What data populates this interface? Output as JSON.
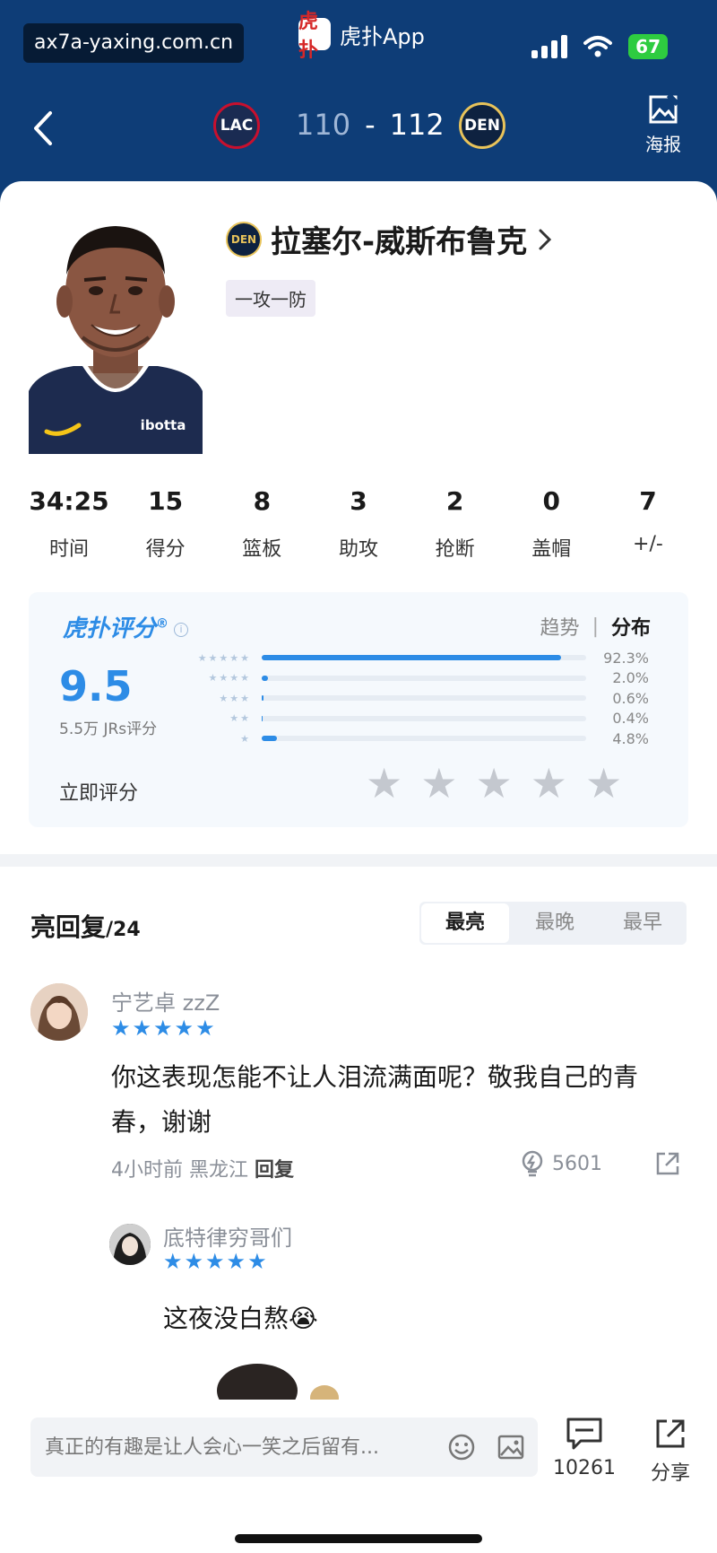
{
  "status_bar": {
    "watermark": "ax7a-yaxing.com.cn",
    "app_logo": "虎扑",
    "app_name": "虎扑App",
    "battery": "67"
  },
  "game_header": {
    "home_team_logo": "LAC",
    "away_team_logo": "DEN",
    "home_score": "110",
    "score_separator": "-",
    "away_score": "112",
    "poster_label": "海报"
  },
  "player": {
    "team_logo": "DEN",
    "name": "拉塞尔-威斯布鲁克",
    "tag": "一攻一防",
    "jersey_sponsor": "ibotta"
  },
  "stats": [
    {
      "value": "34:25",
      "label": "时间"
    },
    {
      "value": "15",
      "label": "得分"
    },
    {
      "value": "8",
      "label": "篮板"
    },
    {
      "value": "3",
      "label": "助攻"
    },
    {
      "value": "2",
      "label": "抢断"
    },
    {
      "value": "0",
      "label": "盖帽"
    },
    {
      "value": "7",
      "label": "+/-"
    }
  ],
  "rating": {
    "brand": "虎扑评分",
    "brand_mark": "®",
    "info_icon": "i",
    "tab_trend": "趋势",
    "tab_separator": "|",
    "tab_dist": "分布",
    "score": "9.5",
    "raters": "5.5万 JRs评分",
    "distribution": [
      {
        "stars": "★★★★★",
        "pct": "92.3%",
        "fraction": 0.923
      },
      {
        "stars": "★★★★",
        "pct": "2.0%",
        "fraction": 0.02
      },
      {
        "stars": "★★★",
        "pct": "0.6%",
        "fraction": 0.006
      },
      {
        "stars": "★★",
        "pct": "0.4%",
        "fraction": 0.004
      },
      {
        "stars": "★",
        "pct": "4.8%",
        "fraction": 0.048
      }
    ],
    "rate_now_label": "立即评分",
    "rate_star_glyph": "★",
    "accent_color": "#2d8ce6"
  },
  "replies": {
    "title": "亮回复",
    "count": "/24",
    "sort_tabs": [
      "最亮",
      "最晚",
      "最早"
    ],
    "comments": [
      {
        "user": "宁艺卓 zzZ",
        "stars": "★★★★★",
        "text": "你这表现怎能不让人泪流满面呢？敬我自己的青春，谢谢",
        "meta": "4小时前 黑龙江",
        "reply_label": "回复",
        "likes": "5601"
      },
      {
        "user": "底特律穷哥们",
        "stars": "★★★★★",
        "text": "这夜没白熬😭"
      }
    ]
  },
  "bottom_bar": {
    "input_placeholder": "真正的有趣是让人会心一笑之后留有...",
    "comment_count": "10261",
    "share_label": "分享"
  }
}
